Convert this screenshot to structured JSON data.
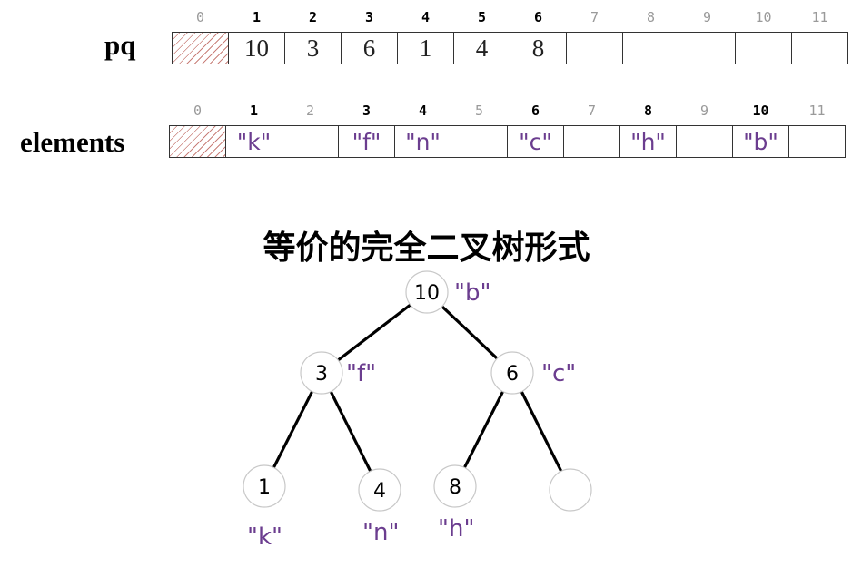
{
  "pq": {
    "label": "pq",
    "indices": [
      "0",
      "1",
      "2",
      "3",
      "4",
      "5",
      "6",
      "7",
      "8",
      "9",
      "10",
      "11"
    ],
    "values": [
      "",
      "10",
      "3",
      "6",
      "1",
      "4",
      "8",
      "",
      "",
      "",
      "",
      ""
    ]
  },
  "elements": {
    "label": "elements",
    "indices": [
      "0",
      "1",
      "2",
      "3",
      "4",
      "5",
      "6",
      "7",
      "8",
      "9",
      "10",
      "11"
    ],
    "values": [
      "",
      "\"k\"",
      "",
      "\"f\"",
      "\"n\"",
      "",
      "\"c\"",
      "",
      "\"h\"",
      "",
      "\"b\"",
      ""
    ]
  },
  "tree": {
    "title": "等价的完全二叉树形式",
    "nodes": [
      {
        "value": "10",
        "label": "\"b\""
      },
      {
        "value": "3",
        "label": "\"f\""
      },
      {
        "value": "6",
        "label": "\"c\""
      },
      {
        "value": "1",
        "label": "\"k\""
      },
      {
        "value": "4",
        "label": "\"n\""
      },
      {
        "value": "8",
        "label": "\"h\""
      },
      {
        "value": "",
        "label": ""
      }
    ],
    "edges": [
      [
        0,
        1
      ],
      [
        0,
        2
      ],
      [
        1,
        3
      ],
      [
        1,
        4
      ],
      [
        2,
        5
      ],
      [
        2,
        6
      ]
    ]
  }
}
